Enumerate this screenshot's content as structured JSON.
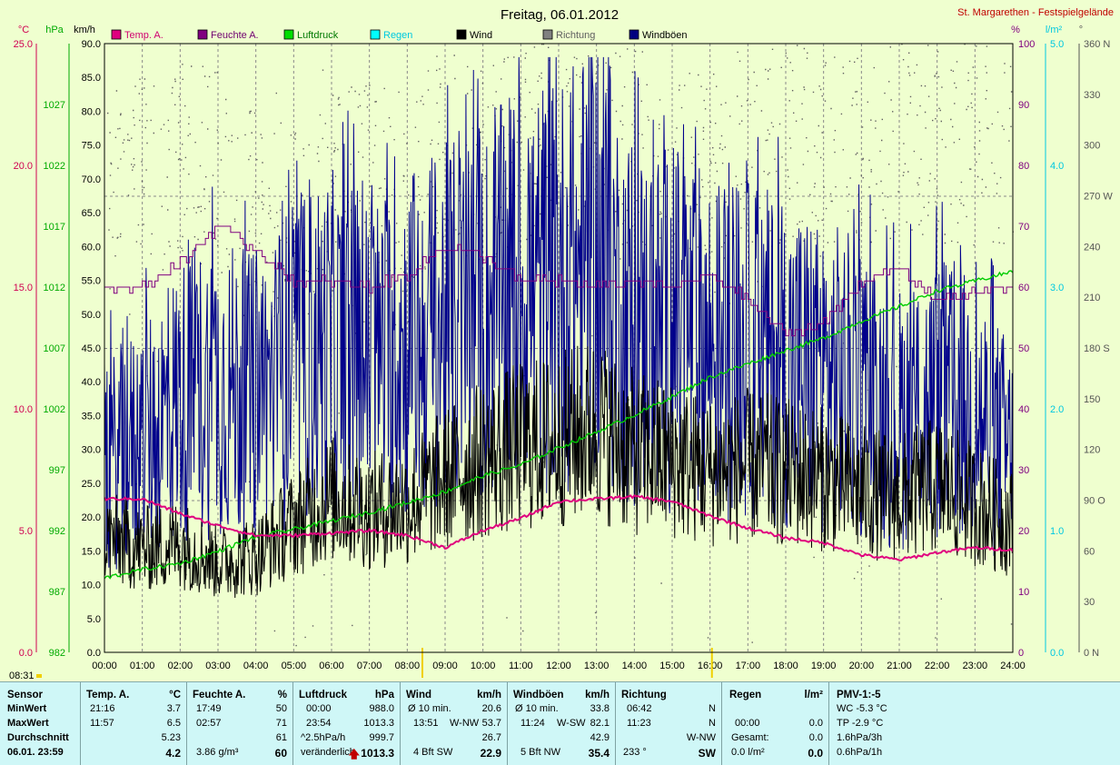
{
  "header": {
    "title": "Freitag, 06.01.2012",
    "station": "St. Margarethen - Festspielgelände"
  },
  "units": {
    "temp": "°C",
    "press": "hPa",
    "wind": "km/h",
    "hum": "%",
    "rain": "l/m²",
    "dir": "°"
  },
  "legend": [
    {
      "label": "Temp. A.",
      "color": "#e0007f"
    },
    {
      "label": "Feuchte A.",
      "color": "#800080"
    },
    {
      "label": "Luftdruck",
      "color": "#00dd00"
    },
    {
      "label": "Regen",
      "color": "#00ffff"
    },
    {
      "label": "Wind",
      "color": "#000000"
    },
    {
      "label": "Richtung",
      "color": "#808080"
    },
    {
      "label": "Windböen",
      "color": "#000080"
    }
  ],
  "colors": {
    "temp": "#e0007f",
    "hum": "#800080",
    "press": "#00cc00",
    "rain": "#00e0e0",
    "wind": "#000000",
    "dir": "#606060",
    "gust": "#00008b"
  },
  "axes": {
    "temp_ticks": [
      "25.0",
      "20.0",
      "15.0",
      "10.0",
      "5.0",
      "0.0"
    ],
    "press_ticks": [
      "1027",
      "1022",
      "1017",
      "1012",
      "1007",
      "1002",
      "997",
      "992",
      "987",
      "982"
    ],
    "wind_ticks": [
      "90.0",
      "85.0",
      "80.0",
      "75.0",
      "70.0",
      "65.0",
      "60.0",
      "55.0",
      "50.0",
      "45.0",
      "40.0",
      "35.0",
      "30.0",
      "25.0",
      "20.0",
      "15.0",
      "10.0",
      "5.0",
      "0.0"
    ],
    "hum_ticks": [
      "100",
      "90",
      "80",
      "70",
      "60",
      "50",
      "40",
      "30",
      "20",
      "10",
      "0"
    ],
    "rain_ticks": [
      "5.0",
      "4.0",
      "3.0",
      "2.0",
      "1.0",
      "0.0"
    ],
    "dir_ticks": [
      "360 N",
      "330",
      "300",
      "270 W",
      "240",
      "210",
      "180 S",
      "150",
      "120",
      "90 O",
      "60",
      "30",
      "0 N"
    ],
    "time_ticks": [
      "00:00",
      "01:00",
      "02:00",
      "03:00",
      "04:00",
      "05:00",
      "06:00",
      "07:00",
      "08:00",
      "09:00",
      "10:00",
      "11:00",
      "12:00",
      "13:00",
      "14:00",
      "15:00",
      "16:00",
      "17:00",
      "18:00",
      "19:00",
      "20:00",
      "21:00",
      "22:00",
      "23:00",
      "24:00"
    ],
    "time_marker": "08:31"
  },
  "chart_data": {
    "type": "line",
    "title": "Freitag, 06.01.2012",
    "x": [
      "00:00",
      "01:00",
      "02:00",
      "03:00",
      "04:00",
      "05:00",
      "06:00",
      "07:00",
      "08:00",
      "09:00",
      "10:00",
      "11:00",
      "12:00",
      "13:00",
      "14:00",
      "15:00",
      "16:00",
      "17:00",
      "18:00",
      "19:00",
      "20:00",
      "21:00",
      "22:00",
      "23:00",
      "24:00"
    ],
    "xlim": [
      0,
      24
    ],
    "series": [
      {
        "name": "Temp. A.",
        "unit": "°C",
        "ylim": [
          0,
          25
        ],
        "values": [
          6.3,
          6.3,
          5.7,
          5.2,
          4.8,
          4.8,
          4.9,
          5.0,
          4.8,
          4.3,
          5.0,
          5.5,
          6.2,
          6.3,
          6.4,
          6.2,
          5.6,
          5.1,
          4.7,
          4.5,
          4.0,
          3.8,
          4.1,
          4.3,
          4.2
        ]
      },
      {
        "name": "Feuchte A.",
        "unit": "%",
        "ylim": [
          0,
          100
        ],
        "values": [
          60,
          60,
          64,
          70,
          66,
          61,
          61,
          60,
          62,
          67,
          65,
          61,
          61,
          60,
          61,
          60,
          62,
          58,
          52,
          54,
          61,
          63,
          58,
          59,
          60
        ]
      },
      {
        "name": "Luftdruck",
        "unit": "hPa",
        "ylim": [
          982,
          1032
        ],
        "values": [
          988.1,
          988.8,
          989.3,
          990.3,
          991.5,
          992.1,
          992.8,
          993.5,
          994.3,
          995.2,
          996.5,
          997.4,
          998.8,
          1000.1,
          1001.5,
          1003.0,
          1004.6,
          1005.7,
          1006.8,
          1007.8,
          1009.2,
          1010.4,
          1011.7,
          1012.5,
          1013.3
        ]
      },
      {
        "name": "Regen",
        "unit": "l/m²",
        "ylim": [
          0,
          5
        ],
        "values": [
          0,
          0,
          0,
          0,
          0,
          0,
          0,
          0,
          0,
          0,
          0,
          0,
          0,
          0,
          0,
          0,
          0,
          0,
          0,
          0,
          0,
          0,
          0,
          0,
          0
        ]
      },
      {
        "name": "Wind",
        "unit": "km/h",
        "ylim": [
          0,
          90
        ],
        "values": [
          18,
          16,
          17,
          14,
          15,
          20,
          24,
          22,
          23,
          27,
          30,
          32,
          33,
          35,
          31,
          30,
          28,
          29,
          28,
          27,
          25,
          24,
          26,
          23,
          20
        ]
      },
      {
        "name": "Windböen",
        "unit": "km/h",
        "ylim": [
          0,
          90
        ],
        "values": [
          33,
          38,
          45,
          48,
          45,
          52,
          55,
          52,
          55,
          58,
          60,
          65,
          66,
          70,
          58,
          58,
          55,
          54,
          52,
          50,
          47,
          42,
          45,
          43,
          35
        ]
      },
      {
        "name": "Richtung",
        "unit": "°",
        "ylim": [
          0,
          360
        ],
        "values": [
          300,
          280,
          290,
          290,
          260,
          250,
          270,
          280,
          270,
          300,
          290,
          300,
          305,
          300,
          300,
          300,
          290,
          300,
          300,
          300,
          295,
          300,
          300,
          305,
          300
        ]
      }
    ]
  },
  "stats": {
    "sensor": {
      "title": "Sensor",
      "rows": [
        "MinWert",
        "MaxWert",
        "Durchschnitt",
        "06.01. 23:59"
      ]
    },
    "temp": {
      "title": "Temp. A.",
      "unit": "°C",
      "rows": [
        [
          "21:16",
          "3.7"
        ],
        [
          "11:57",
          "6.5"
        ],
        [
          "",
          "5.23"
        ],
        [
          "",
          "4.2"
        ]
      ]
    },
    "hum": {
      "title": "Feuchte A.",
      "unit": "%",
      "rows": [
        [
          "17:49",
          "50"
        ],
        [
          "02:57",
          "71"
        ],
        [
          "",
          "61"
        ],
        [
          "3.86 g/m³",
          "60"
        ]
      ]
    },
    "press": {
      "title": "Luftdruck",
      "unit": "hPa",
      "rows": [
        [
          "00:00",
          "988.0"
        ],
        [
          "23:54",
          "1013.3"
        ],
        [
          "^2.5hPa/h",
          "999.7"
        ],
        [
          "veränderlich",
          "1013.3"
        ]
      ],
      "arrow": "🡅"
    },
    "wind": {
      "title": "Wind",
      "unit": "km/h",
      "rows": [
        [
          "Ø 10 min.",
          "",
          "20.6"
        ],
        [
          "13:51",
          "W-NW",
          "53.7"
        ],
        [
          "",
          "",
          "26.7"
        ],
        [
          "4 Bft SW",
          "",
          "22.9"
        ]
      ]
    },
    "gust": {
      "title": "Windböen",
      "unit": "km/h",
      "rows": [
        [
          "Ø 10 min.",
          "",
          "33.8"
        ],
        [
          "11:24",
          "W-SW",
          "82.1"
        ],
        [
          "",
          "",
          "42.9"
        ],
        [
          "5 Bft NW",
          "",
          "35.4"
        ]
      ]
    },
    "dir": {
      "title": "Richtung",
      "unit": "",
      "rows": [
        [
          "06:42",
          "N"
        ],
        [
          "11:23",
          "N"
        ],
        [
          "",
          "W-NW"
        ],
        [
          "233 °",
          "SW"
        ]
      ]
    },
    "rain": {
      "title": "Regen",
      "unit": "l/m²",
      "rows": [
        [
          "",
          ""
        ],
        [
          "00:00",
          "0.0"
        ],
        [
          "Gesamt:",
          "0.0"
        ],
        [
          "0.0 l/m²",
          "0.0"
        ]
      ]
    },
    "pmv": {
      "title": "PMV-1:-5",
      "rows": [
        "WC -5.3 °C",
        "TP -2.9 °C",
        "1.6hPa/3h",
        "0.6hPa/1h"
      ]
    }
  }
}
